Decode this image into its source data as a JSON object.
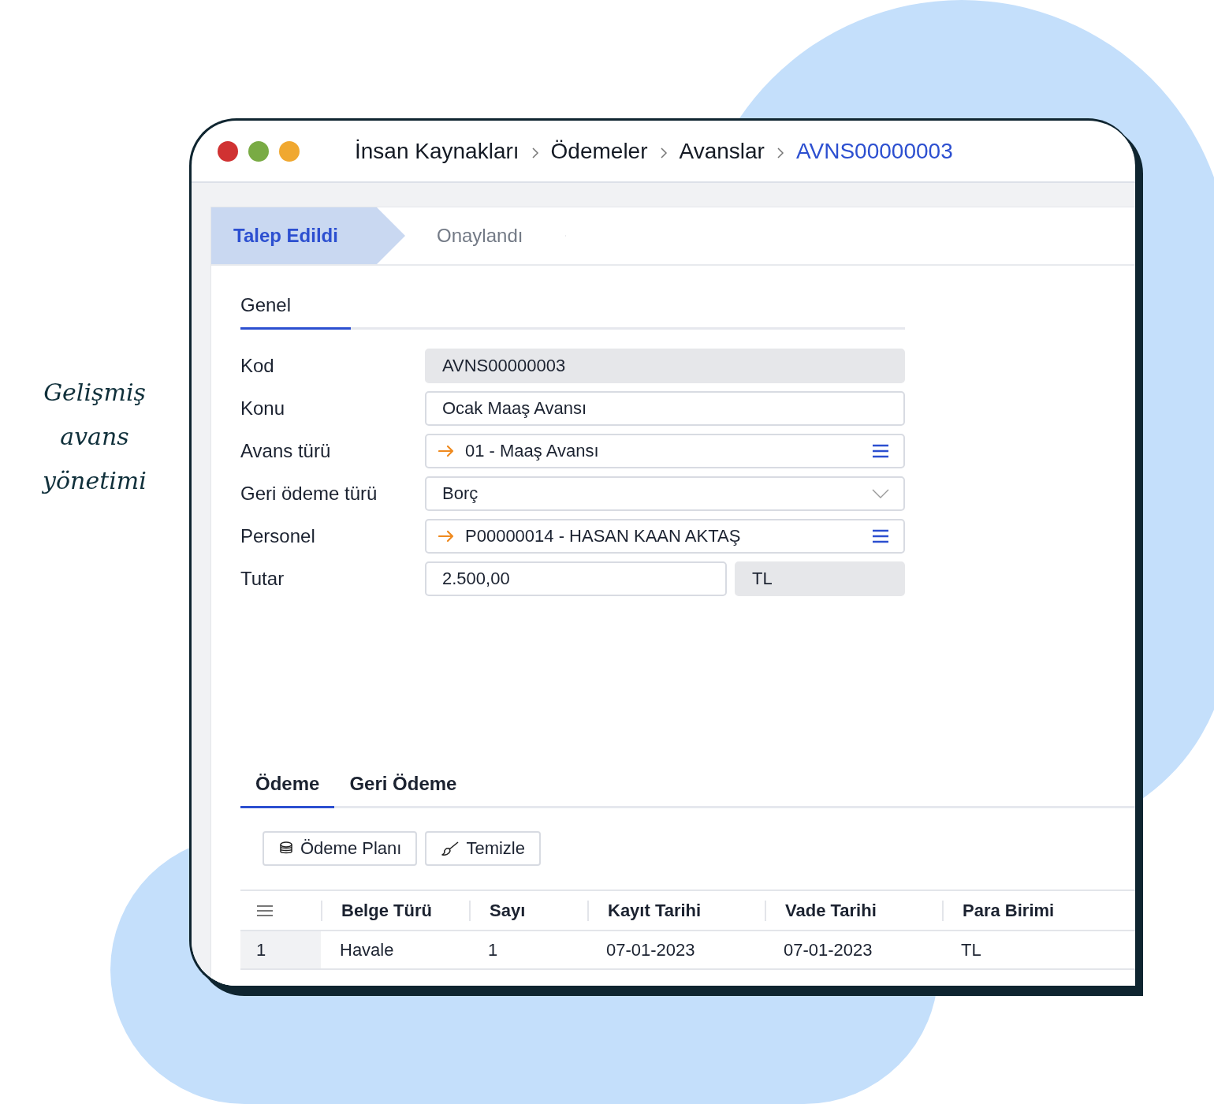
{
  "caption": "Gelişmiş avans yönetimi",
  "window": {
    "breadcrumb": [
      {
        "label": "İnsan Kaynakları",
        "selected": false
      },
      {
        "label": "Ödemeler",
        "selected": false
      },
      {
        "label": "Avanslar",
        "selected": false
      },
      {
        "label": "AVNS00000003",
        "selected": true
      }
    ]
  },
  "steps": [
    {
      "label": "Talep Edildi",
      "selected": true
    },
    {
      "label": "Onaylandı",
      "selected": false
    }
  ],
  "form_tabs": [
    {
      "label": "Genel",
      "selected": true
    }
  ],
  "fields": [
    {
      "label": "Kod",
      "kind": "readonly",
      "value": "AVNS00000003"
    },
    {
      "label": "Konu",
      "kind": "text",
      "value": "Ocak Maaş Avansı"
    },
    {
      "label": "Avans türü",
      "kind": "lookup",
      "value": "01 - Maaş Avansı"
    },
    {
      "label": "Geri ödeme türü",
      "kind": "select",
      "value": "Borç"
    },
    {
      "label": "Personel",
      "kind": "lookup",
      "value": "P00000014 - HASAN KAAN AKTAŞ"
    },
    {
      "label": "Tutar",
      "kind": "amount",
      "value": "2.500,00",
      "currency": "TL"
    }
  ],
  "detail_tabs": [
    {
      "label": "Ödeme",
      "selected": true
    },
    {
      "label": "Geri Ödeme",
      "selected": false
    }
  ],
  "toolbar": [
    {
      "label": "Ödeme Planı",
      "kind": "coins"
    },
    {
      "label": "Temizle",
      "kind": "brush"
    }
  ],
  "table": {
    "columns": [
      "Belge Türü",
      "Sayı",
      "Kayıt Tarihi",
      "Vade Tarihi",
      "Para Birimi"
    ],
    "rows": [
      {
        "number": "1",
        "cells": [
          "Havale",
          "1",
          "07-01-2023",
          "07-01-2023",
          "TL"
        ]
      }
    ]
  }
}
